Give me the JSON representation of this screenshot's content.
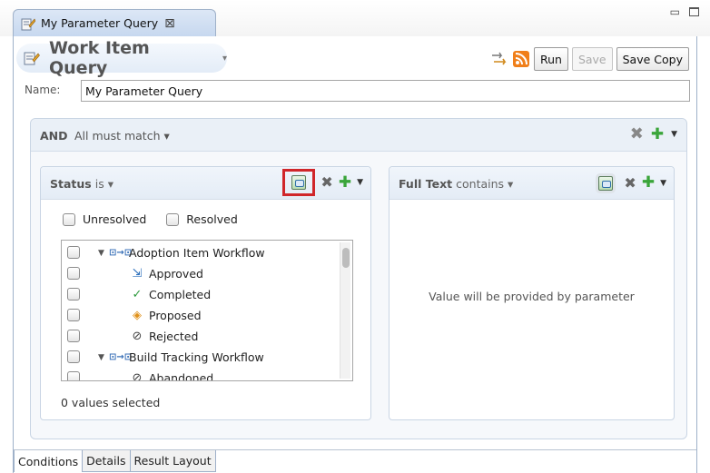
{
  "tab": {
    "title": "My Parameter Query",
    "close": "⊠",
    "minimize": "▭"
  },
  "header": {
    "title": "Work Item Query",
    "dropdown": "▾"
  },
  "toolbar": {
    "run": "Run",
    "save": "Save",
    "save_copy": "Save Copy"
  },
  "name": {
    "label": "Name:",
    "value": "My Parameter Query"
  },
  "group": {
    "operator": "AND",
    "description": "All must match ▾"
  },
  "status_card": {
    "attribute": "Status",
    "operator": "is ▾",
    "quick_filters": [
      {
        "label": "Unresolved"
      },
      {
        "label": "Resolved"
      }
    ],
    "items": [
      {
        "kind": "workflow",
        "label": "Adoption Item Workflow",
        "twisty": "▼",
        "icon": "⊡→⊡"
      },
      {
        "kind": "state",
        "label": "Approved",
        "icon": "⇲",
        "icon_name": "approved-icon",
        "color": "#2c6fbb"
      },
      {
        "kind": "state",
        "label": "Completed",
        "icon": "✓",
        "icon_name": "checkmark-icon",
        "color": "#2e9a3e"
      },
      {
        "kind": "state",
        "label": "Proposed",
        "icon": "◈",
        "icon_name": "proposed-icon",
        "color": "#e0911a"
      },
      {
        "kind": "state",
        "label": "Rejected",
        "icon": "⊘",
        "icon_name": "rejected-icon",
        "color": "#444444"
      },
      {
        "kind": "workflow",
        "label": "Build Tracking Workflow",
        "twisty": "▼",
        "icon": "⊡→⊡"
      },
      {
        "kind": "state",
        "label": "Abandoned",
        "icon": "⊘",
        "icon_name": "abandoned-icon",
        "color": "#444444"
      }
    ],
    "selection_count": "0 values selected"
  },
  "fulltext_card": {
    "attribute": "Full Text",
    "operator": "contains ▾",
    "message": "Value will be provided by parameter"
  },
  "bottom_tabs": [
    {
      "label": "Conditions",
      "active": true
    },
    {
      "label": "Details",
      "active": false
    },
    {
      "label": "Result Layout",
      "active": false
    }
  ],
  "colors": {
    "accent_border": "#9fb1c9",
    "highlight": "#d0262a",
    "add_green": "#3aa53a"
  }
}
